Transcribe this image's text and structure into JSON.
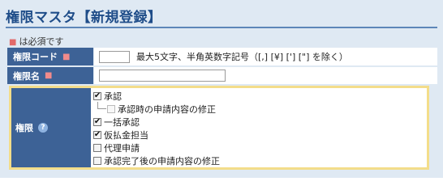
{
  "header": {
    "title": "権限マスタ【新規登録】"
  },
  "required_note": {
    "mark": "■",
    "text": "は必須です"
  },
  "form": {
    "code": {
      "label": "権限コード",
      "required_mark": "■",
      "value": "",
      "hint": "最大5文字、半角英数字記号（[,] [¥] ['] [\"] を除く）"
    },
    "name": {
      "label": "権限名",
      "required_mark": "■",
      "value": ""
    },
    "permissions": {
      "label": "権限",
      "help_icon": "?",
      "items": [
        {
          "label": "承認",
          "checked": true,
          "indent": 0
        },
        {
          "label": "承認時の申請内容の修正",
          "checked": false,
          "indent": 1
        },
        {
          "label": "一括承認",
          "checked": true,
          "indent": 0
        },
        {
          "label": "仮払金担当",
          "checked": true,
          "indent": 0
        },
        {
          "label": "代理申請",
          "checked": false,
          "indent": 0
        },
        {
          "label": "承認完了後の申請内容の修正",
          "checked": false,
          "indent": 0
        }
      ]
    }
  },
  "colors": {
    "label_bg": "#3d6296",
    "title": "#1f4d89",
    "highlight_border": "#f3dd8a",
    "required": "#e26a6a"
  }
}
